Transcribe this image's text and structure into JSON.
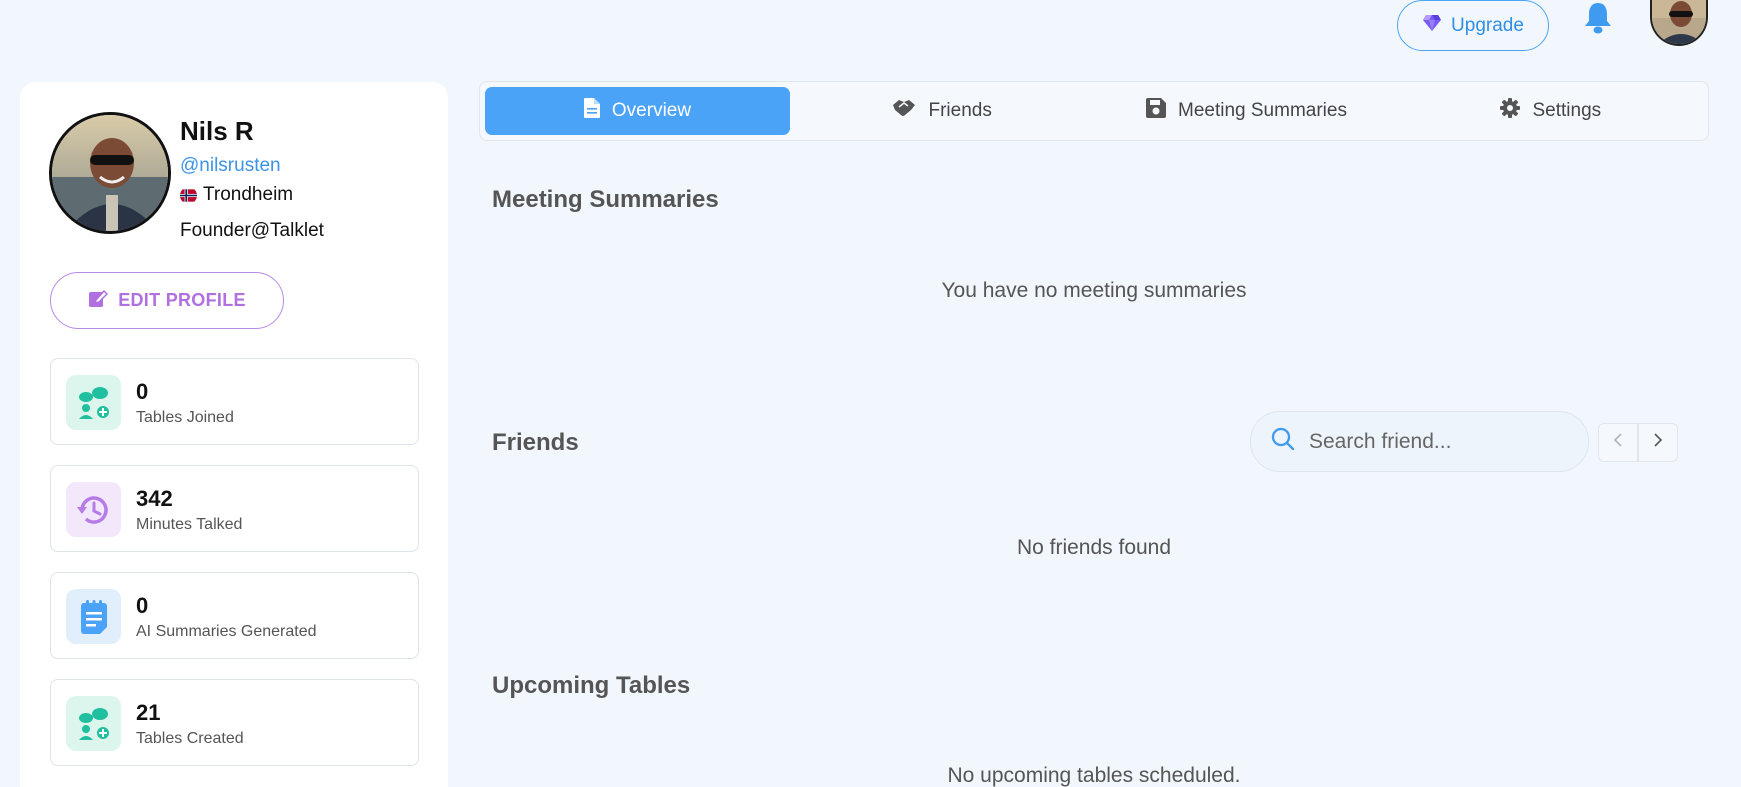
{
  "header": {
    "upgrade_label": "Upgrade",
    "icons": {
      "upgrade": "diamond-icon",
      "notifications": "bell-icon",
      "avatar": "user-avatar"
    }
  },
  "profile": {
    "name": "Nils R",
    "handle": "@nilsrusten",
    "location": "Trondheim",
    "bio": "Founder@Talklet",
    "edit_label": "EDIT PROFILE"
  },
  "stats": [
    {
      "value": "0",
      "label": "Tables Joined",
      "icon": "chat-group-add-icon",
      "color": "#1fbf9f"
    },
    {
      "value": "342",
      "label": "Minutes Talked",
      "icon": "history-clock-icon",
      "color": "#b57be6"
    },
    {
      "value": "0",
      "label": "AI Summaries Generated",
      "icon": "notepad-icon",
      "color": "#4aa3f7"
    },
    {
      "value": "21",
      "label": "Tables Created",
      "icon": "chat-group-add-icon",
      "color": "#1fbf9f"
    }
  ],
  "tabs": [
    {
      "label": "Overview",
      "icon": "document-icon",
      "active": true
    },
    {
      "label": "Friends",
      "icon": "handshake-icon",
      "active": false
    },
    {
      "label": "Meeting Summaries",
      "icon": "floppy-disk-icon",
      "active": false
    },
    {
      "label": "Settings",
      "icon": "gear-icon",
      "active": false
    }
  ],
  "sections": {
    "meetings": {
      "title": "Meeting Summaries",
      "empty": "You have no meeting summaries"
    },
    "friends": {
      "title": "Friends",
      "empty": "No friends found",
      "search_placeholder": "Search friend..."
    },
    "upcoming": {
      "title": "Upcoming Tables",
      "empty": "No upcoming tables scheduled."
    }
  },
  "colors": {
    "accent": "#4aa3f7",
    "edit": "#b070e0",
    "background": "#f2f7fd"
  }
}
